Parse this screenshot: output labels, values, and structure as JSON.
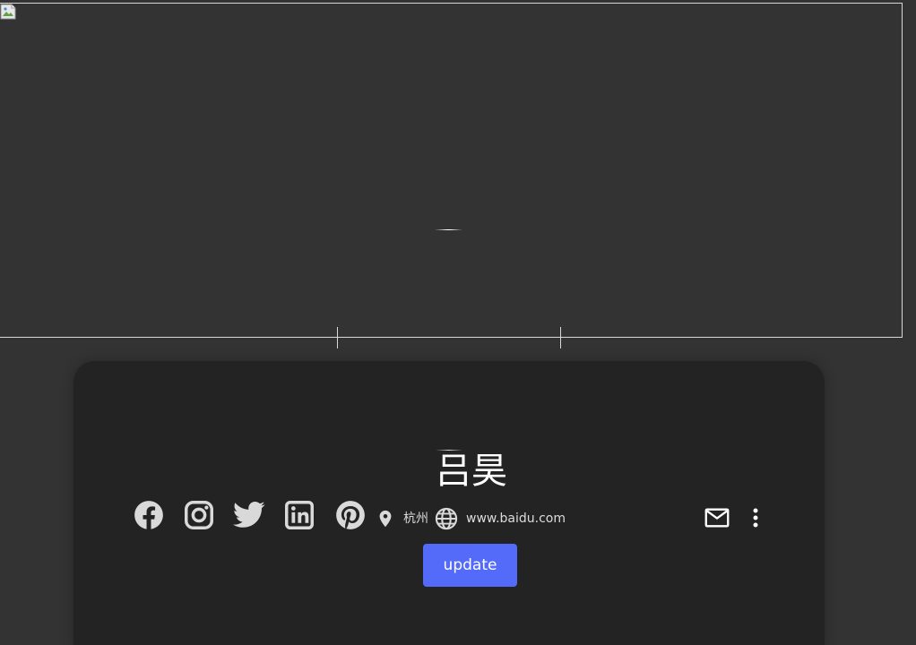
{
  "cover": {
    "icon": "broken-image-icon"
  },
  "profile": {
    "name": "吕昊",
    "location": "杭州",
    "website": "www.baidu.com"
  },
  "social": [
    {
      "name": "facebook",
      "icon": "facebook-icon"
    },
    {
      "name": "instagram",
      "icon": "instagram-icon"
    },
    {
      "name": "twitter",
      "icon": "twitter-icon"
    },
    {
      "name": "linkedin",
      "icon": "linkedin-icon"
    },
    {
      "name": "pinterest",
      "icon": "pinterest-icon"
    }
  ],
  "actions": {
    "update_label": "update",
    "mail_icon": "mail-icon",
    "more_icon": "more-vertical-icon",
    "location_icon": "location-pin-icon",
    "website_icon": "globe-icon"
  },
  "colors": {
    "background": "#333333",
    "card": "#232323",
    "accent": "#546bfa",
    "icon": "#d9d9d9"
  }
}
